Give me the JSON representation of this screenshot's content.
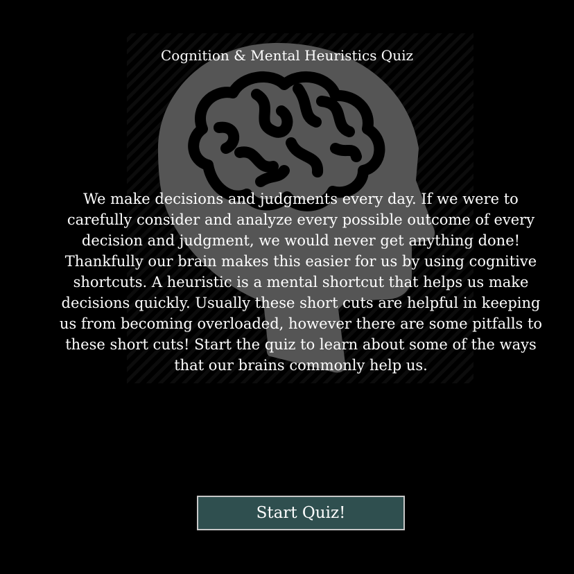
{
  "quiz": {
    "title": "Cognition & Mental Heuristics Quiz",
    "intro": "We make decisions and judgments every day. If we were to carefully consider and analyze every possible outcome of every decision and judgment, we would never get anything done! Thankfully our brain makes this easier for us by using cognitive shortcuts. A heuristic is a mental shortcut that helps us make decisions quickly. Usually these short cuts are helpful in keeping us from becoming overloaded, however there are some pitfalls to these short cuts! Start the quiz to learn about some of the ways that our brains commonly help us.",
    "start_button_label": "Start Quiz!"
  },
  "background": {
    "icon": "head-brain-icon",
    "page_color": "#000000",
    "head_color": "#555555",
    "brain_color": "#000000"
  },
  "colors": {
    "button_background": "#2f4f4f",
    "button_border": "#c8c8c8",
    "text": "#ffffff"
  }
}
